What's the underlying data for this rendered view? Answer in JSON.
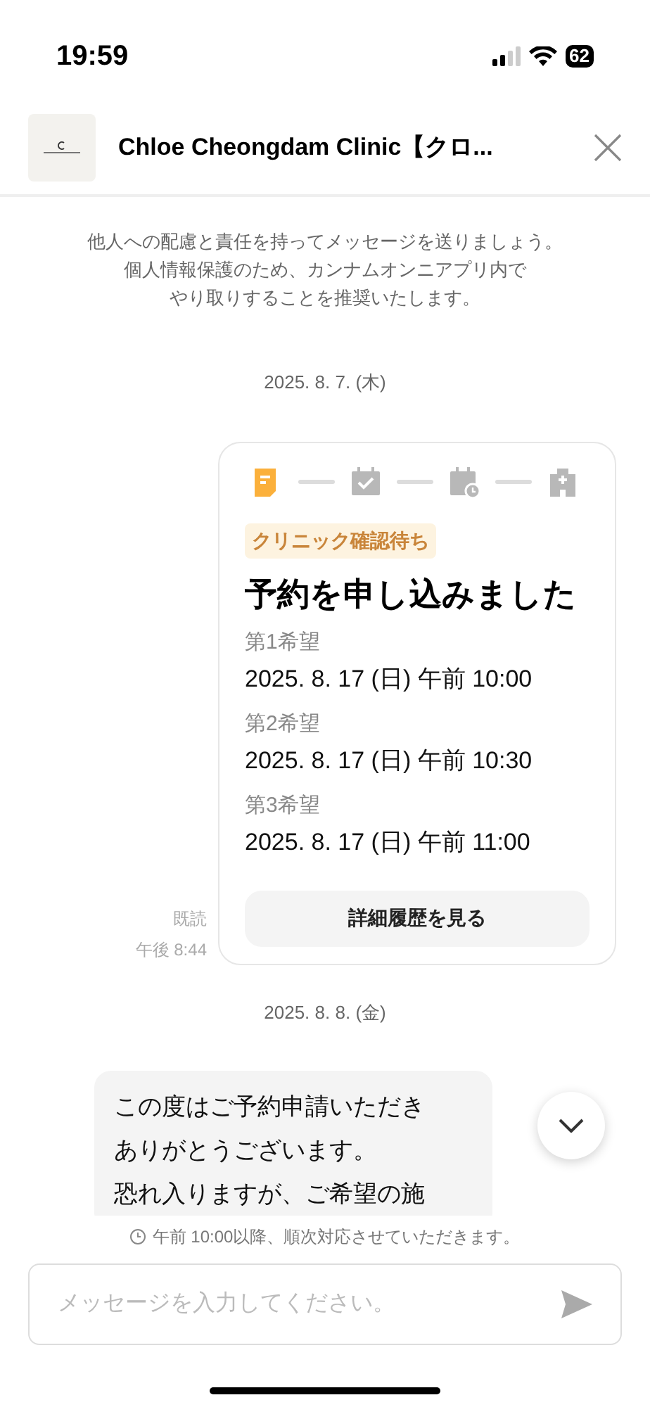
{
  "status_bar": {
    "time": "19:59",
    "battery": "62"
  },
  "header": {
    "title": "Chloe Cheongdam Clinic【クロ..."
  },
  "notice": [
    "他人への配慮と責任を持ってメッセージを送りましょう。",
    "個人情報保護のため、カンナムオンニアプリ内で",
    "やり取りすることを推奨いたします。"
  ],
  "messages": [
    {
      "kind": "date",
      "text": "2025. 8. 7. (木)"
    },
    {
      "kind": "card",
      "read": "既読",
      "time": "午後 8:44",
      "steps": [
        {
          "kind": "request",
          "active": true
        },
        {
          "kind": "confirmed",
          "active": false
        },
        {
          "kind": "scheduled",
          "active": false
        },
        {
          "kind": "clinic",
          "active": false
        }
      ],
      "badge": "クリニック確認待ち",
      "title": "予約を申し込みました",
      "choices": [
        {
          "label": "第1希望",
          "value": "2025. 8. 17 (日) 午前 10:00"
        },
        {
          "label": "第2希望",
          "value": "2025. 8. 17 (日) 午前 10:30"
        },
        {
          "label": "第3希望",
          "value": "2025. 8. 17 (日) 午前 11:00"
        }
      ],
      "button": "詳細履歴を見る"
    },
    {
      "kind": "date",
      "text": "2025. 8. 8. (金)"
    },
    {
      "kind": "incoming",
      "lines": [
        "この度はご予約申請いただき",
        "ありがとうございます。",
        "恐れ入りますが、ご希望の施"
      ]
    }
  ],
  "hours_note": "午前 10:00以降、順次対応させていただきます。",
  "composer": {
    "placeholder": "メッセージを入力してください。"
  }
}
